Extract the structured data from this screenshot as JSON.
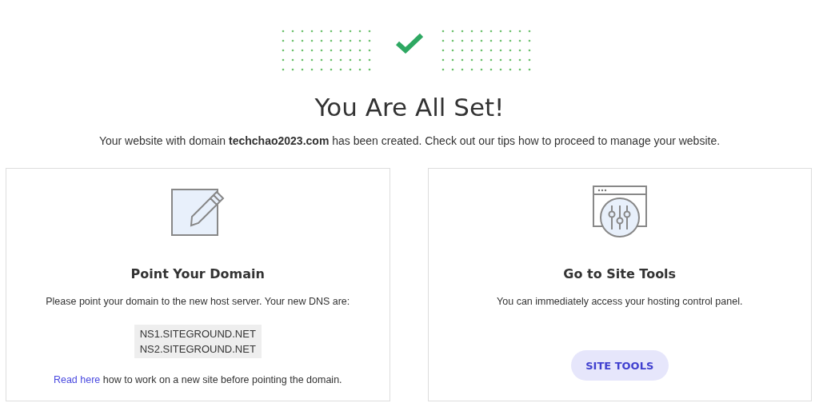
{
  "header": {
    "title": "You Are All Set!",
    "subtitle": "Your website with domain **techchao2023.com** has been created. Check out our tips how to proceed to manage your website."
  },
  "cards": [
    {
      "kind": "domain",
      "title": "Point Your Domain",
      "text": "Please point your domain to the new host server. Your new DNS are:",
      "dns": [
        "NS1.SITEGROUND.NET",
        "NS2.SITEGROUND.NET"
      ],
      "link": "Read here",
      "link_rest": " how to work on a new site before pointing the domain."
    },
    {
      "kind": "tools",
      "title": "Go to Site Tools",
      "text": "You can immediately access your hosting control panel.",
      "button": "SITE TOOLS"
    }
  ]
}
